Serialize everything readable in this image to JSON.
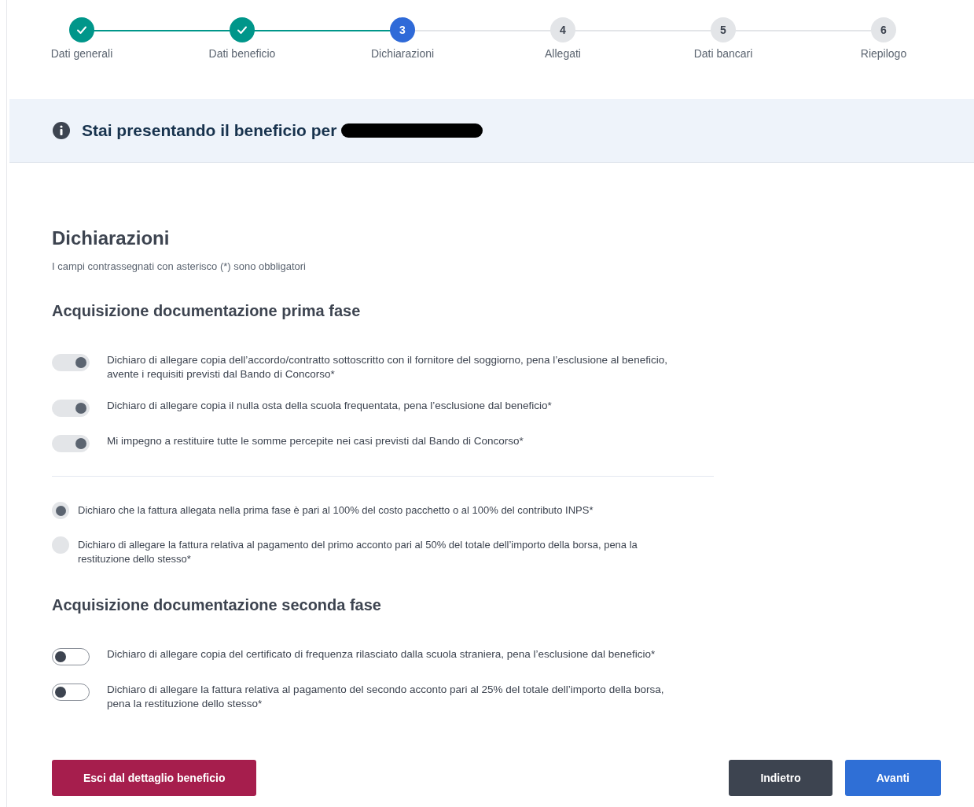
{
  "stepper": [
    {
      "label": "Dati generali",
      "completed": true,
      "current": false
    },
    {
      "label": "Dati beneficio",
      "completed": true,
      "current": false
    },
    {
      "label": "Dichiarazioni",
      "completed": false,
      "current": true,
      "number": "3"
    },
    {
      "label": "Allegati",
      "completed": false,
      "current": false,
      "number": "4"
    },
    {
      "label": "Dati bancari",
      "completed": false,
      "current": false,
      "number": "5"
    },
    {
      "label": "Riepilogo",
      "completed": false,
      "current": false,
      "number": "6"
    }
  ],
  "banner": {
    "text": "Stai presentando il beneficio per"
  },
  "title": "Dichiarazioni",
  "subtitle": "I campi contrassegnati con asterisco (*) sono obbligatori",
  "sections": [
    {
      "heading": "Acquisizione documentazione prima fase",
      "groups": [
        {
          "kind": "toggle",
          "items": [
            {
              "label": "Dichiaro di allegare copia dell’accordo/contratto sottoscritto con il fornitore del soggiorno, pena l’esclusione al beneficio, avente i requisiti previsti dal Bando di Concorso*",
              "on": true,
              "disabled": true
            },
            {
              "label": "Dichiaro di allegare copia il nulla osta della scuola frequentata, pena l’esclusione dal beneficio*",
              "on": true,
              "disabled": true
            },
            {
              "label": "Mi impegno a restituire tutte le somme percepite nei casi previsti dal Bando di Concorso*",
              "on": true,
              "disabled": true
            }
          ]
        },
        {
          "kind": "radio",
          "items": [
            {
              "label": "Dichiaro che la fattura allegata nella prima fase è pari al 100% del costo pacchetto o al 100% del contributo INPS*",
              "selected": true,
              "disabled": true
            },
            {
              "label": "Dichiaro di allegare la fattura relativa al pagamento del primo acconto pari al 50% del totale dell’importo della borsa, pena la restituzione dello stesso*",
              "selected": false,
              "disabled": true
            }
          ]
        }
      ]
    },
    {
      "heading": "Acquisizione documentazione seconda fase",
      "groups": [
        {
          "kind": "toggle",
          "items": [
            {
              "label": "Dichiaro di allegare copia del certificato di frequenza rilasciato dalla scuola straniera, pena l’esclusione dal beneficio*",
              "on": false,
              "disabled": false
            },
            {
              "label": "Dichiaro di allegare la fattura relativa al pagamento del secondo acconto pari al 25% del totale dell’importo della borsa, pena la restituzione dello stesso*",
              "on": false,
              "disabled": false
            }
          ]
        }
      ]
    }
  ],
  "buttons": [
    {
      "label": "Esci dal dettaglio beneficio",
      "kind": "danger"
    },
    {
      "label": "Indietro",
      "kind": "secondary"
    },
    {
      "label": "Avanti",
      "kind": "primary"
    }
  ]
}
